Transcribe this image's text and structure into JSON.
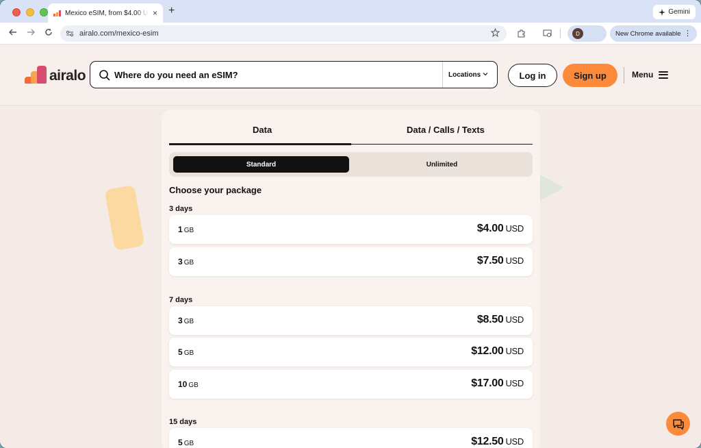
{
  "browser": {
    "tab_title": "Mexico eSIM, from $4.00 USD",
    "new_tab_symbol": "+",
    "close_symbol": "×",
    "gemini_label": "Gemini",
    "url": "airalo.com/mexico-esim",
    "profile_initial": "D",
    "update_label": "New Chrome available"
  },
  "header": {
    "logo_text": "airalo",
    "search_placeholder": "Where do you need an eSIM?",
    "locations_label": "Locations",
    "login_label": "Log in",
    "signup_label": "Sign up",
    "menu_label": "Menu"
  },
  "plans": {
    "tabs": [
      "Data",
      "Data / Calls / Texts"
    ],
    "active_tab": "Data",
    "segments": [
      "Standard",
      "Unlimited"
    ],
    "active_segment": "Standard",
    "choose_label": "Choose your package",
    "groups": [
      {
        "title": "3 days",
        "packages": [
          {
            "amount": "1",
            "unit": "GB",
            "price": "$4.00",
            "currency": "USD"
          },
          {
            "amount": "3",
            "unit": "GB",
            "price": "$7.50",
            "currency": "USD"
          }
        ]
      },
      {
        "title": "7 days",
        "packages": [
          {
            "amount": "3",
            "unit": "GB",
            "price": "$8.50",
            "currency": "USD"
          },
          {
            "amount": "5",
            "unit": "GB",
            "price": "$12.00",
            "currency": "USD"
          },
          {
            "amount": "10",
            "unit": "GB",
            "price": "$17.00",
            "currency": "USD"
          }
        ]
      },
      {
        "title": "15 days",
        "packages": [
          {
            "amount": "5",
            "unit": "GB",
            "price": "$12.50",
            "currency": "USD"
          }
        ]
      }
    ]
  },
  "colors": {
    "accent": "#fb8a3b",
    "page_bg": "#f4ebe6",
    "card_bg": "#f9f2ee",
    "selected_segment": "#111111"
  }
}
